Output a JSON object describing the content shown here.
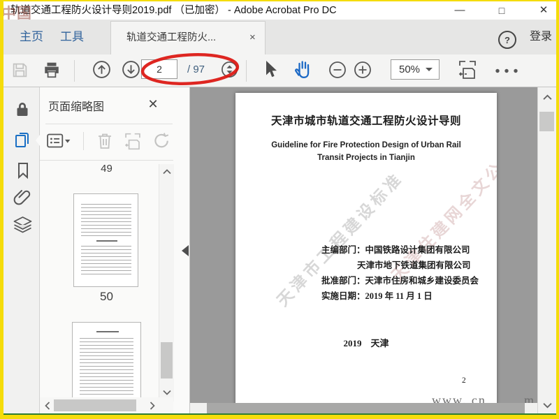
{
  "window": {
    "title": "轨道交通工程防火设计导则2019.pdf （已加密） - Adobe Acrobat Pro DC",
    "watermark": "中国",
    "minimize": "—",
    "maximize": "□",
    "close": "✕"
  },
  "tabs": {
    "home": "主页",
    "tools": "工具",
    "doc_label": "轨道交通工程防火...",
    "doc_close": "×",
    "help": "?",
    "sign_in": "登录"
  },
  "toolbar": {
    "page_value": "2",
    "page_total": "/ 97",
    "zoom_value": "50%"
  },
  "panel": {
    "title": "页面缩略图",
    "close": "✕",
    "label_49": "49",
    "label_50": "50"
  },
  "page": {
    "title_cn": "天津市城市轨道交通工程防火设计导则",
    "title_en_1": "Guideline for Fire Protection Design of Urban Rail",
    "title_en_2": "Transit Projects in Tianjin",
    "fields": [
      {
        "label": "主编部门：",
        "value": "中国铁路设计集团有限公司"
      },
      {
        "label": "",
        "value": "天津市地下铁道集团有限公司"
      },
      {
        "label": "批准部门：",
        "value": "天津市住房和城乡建设委员会"
      },
      {
        "label": "实施日期：",
        "value": "2019 年 11 月 1 日"
      }
    ],
    "year_city": "2019　天津",
    "page_number": "2",
    "watermark_diag_left": "天津市工程建设标准",
    "watermark_diag_right": "天津住建网全文公开",
    "watermark_bottom": "www. cn",
    "watermark_bottom_tail": "m"
  },
  "colors": {
    "accent_blue": "#1a6fc4",
    "annotation_red": "#dc1510",
    "border_yellow": "#f5dc0a",
    "border_green": "#2e7d32"
  }
}
